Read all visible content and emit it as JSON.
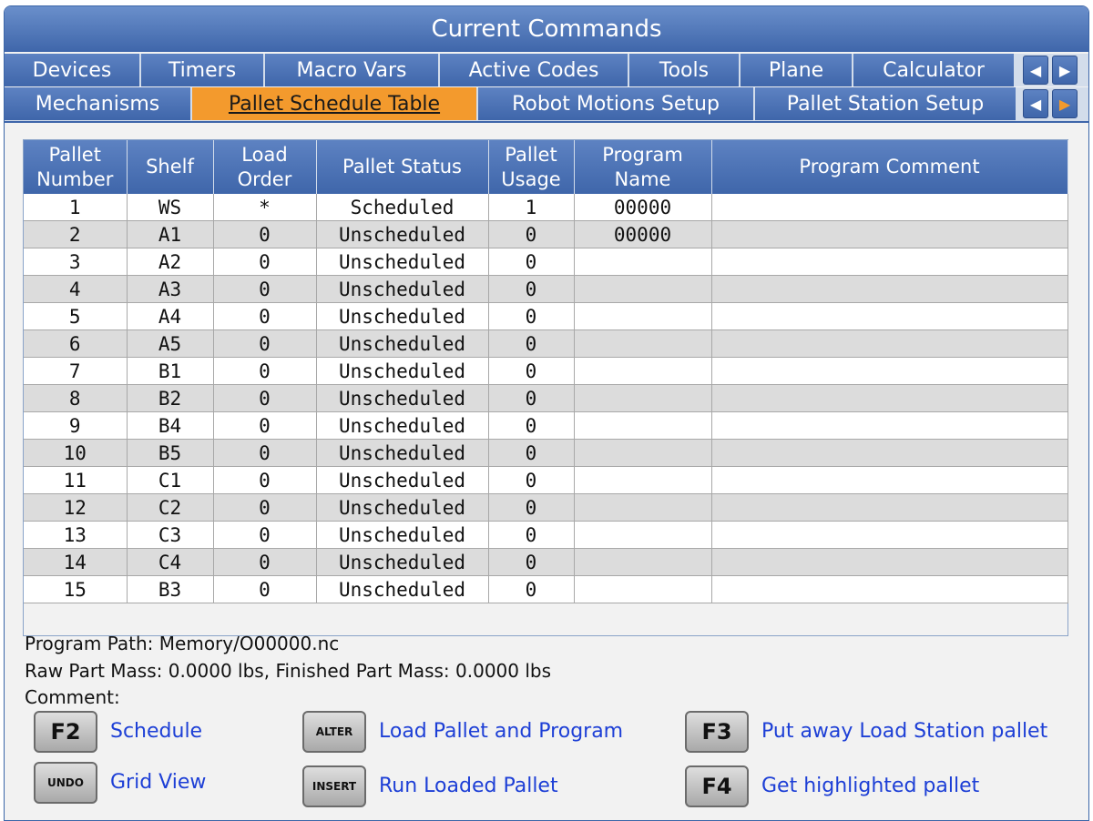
{
  "window": {
    "title": "Current Commands"
  },
  "tabs_row1": [
    {
      "label": "Devices"
    },
    {
      "label": "Timers"
    },
    {
      "label": "Macro Vars"
    },
    {
      "label": "Active Codes"
    },
    {
      "label": "Tools"
    },
    {
      "label": "Plane"
    },
    {
      "label": "Calculator"
    }
  ],
  "tabs_row2": [
    {
      "label": "Mechanisms"
    },
    {
      "label": "Pallet Schedule Table",
      "active": true
    },
    {
      "label": "Robot Motions Setup"
    },
    {
      "label": "Pallet Station Setup"
    }
  ],
  "nav": {
    "left_icon": "◀",
    "right_icon": "▶"
  },
  "table": {
    "headers": [
      "Pallet Number",
      "Shelf",
      "Load Order",
      "Pallet Status",
      "Pallet Usage",
      "Program Name",
      "Program Comment"
    ],
    "rows": [
      [
        "1",
        "WS",
        "*",
        "Scheduled",
        "1",
        "00000",
        ""
      ],
      [
        "2",
        "A1",
        "0",
        "Unscheduled",
        "0",
        "00000",
        ""
      ],
      [
        "3",
        "A2",
        "0",
        "Unscheduled",
        "0",
        "",
        ""
      ],
      [
        "4",
        "A3",
        "0",
        "Unscheduled",
        "0",
        "",
        ""
      ],
      [
        "5",
        "A4",
        "0",
        "Unscheduled",
        "0",
        "",
        ""
      ],
      [
        "6",
        "A5",
        "0",
        "Unscheduled",
        "0",
        "",
        ""
      ],
      [
        "7",
        "B1",
        "0",
        "Unscheduled",
        "0",
        "",
        ""
      ],
      [
        "8",
        "B2",
        "0",
        "Unscheduled",
        "0",
        "",
        ""
      ],
      [
        "9",
        "B4",
        "0",
        "Unscheduled",
        "0",
        "",
        ""
      ],
      [
        "10",
        "B5",
        "0",
        "Unscheduled",
        "0",
        "",
        ""
      ],
      [
        "11",
        "C1",
        "0",
        "Unscheduled",
        "0",
        "",
        ""
      ],
      [
        "12",
        "C2",
        "0",
        "Unscheduled",
        "0",
        "",
        ""
      ],
      [
        "13",
        "C3",
        "0",
        "Unscheduled",
        "0",
        "",
        ""
      ],
      [
        "14",
        "C4",
        "0",
        "Unscheduled",
        "0",
        "",
        ""
      ],
      [
        "15",
        "B3",
        "0",
        "Unscheduled",
        "0",
        "",
        ""
      ]
    ]
  },
  "info": {
    "program_path": "Program Path: Memory/O00000.nc",
    "mass": "Raw Part Mass: 0.0000 lbs, Finished Part Mass: 0.0000 lbs",
    "comment": "Comment:"
  },
  "keys": [
    {
      "key": "F2",
      "label": "Schedule"
    },
    {
      "key": "UNDO",
      "label": "Grid View"
    },
    {
      "key": "ALTER",
      "label": "Load Pallet and Program"
    },
    {
      "key": "INSERT",
      "label": "Run Loaded Pallet"
    },
    {
      "key": "F3",
      "label": "Put away Load Station pallet"
    },
    {
      "key": "F4",
      "label": "Get highlighted pallet"
    }
  ]
}
